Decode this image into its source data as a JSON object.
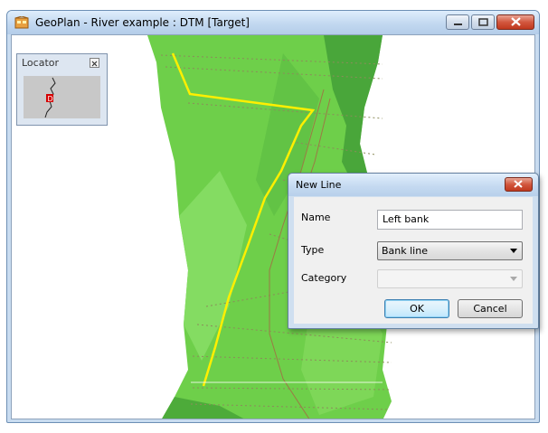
{
  "window": {
    "title": "GeoPlan - River example : DTM  [Target]",
    "icon": "geoplan-app-icon",
    "buttons": [
      "minimize-icon",
      "maximize-icon",
      "close-icon"
    ]
  },
  "locator": {
    "title": "Locator",
    "marker_label": "D"
  },
  "dialog": {
    "title": "New Line",
    "name_label": "Name",
    "name_value": "Left bank",
    "type_label": "Type",
    "type_value": "Bank line",
    "category_label": "Category",
    "category_value": "",
    "ok_label": "OK",
    "cancel_label": "Cancel"
  },
  "colors": {
    "terrain": "#6ecf4a",
    "selected_line": "#ffef00",
    "dialog_close": "#c9452a"
  }
}
